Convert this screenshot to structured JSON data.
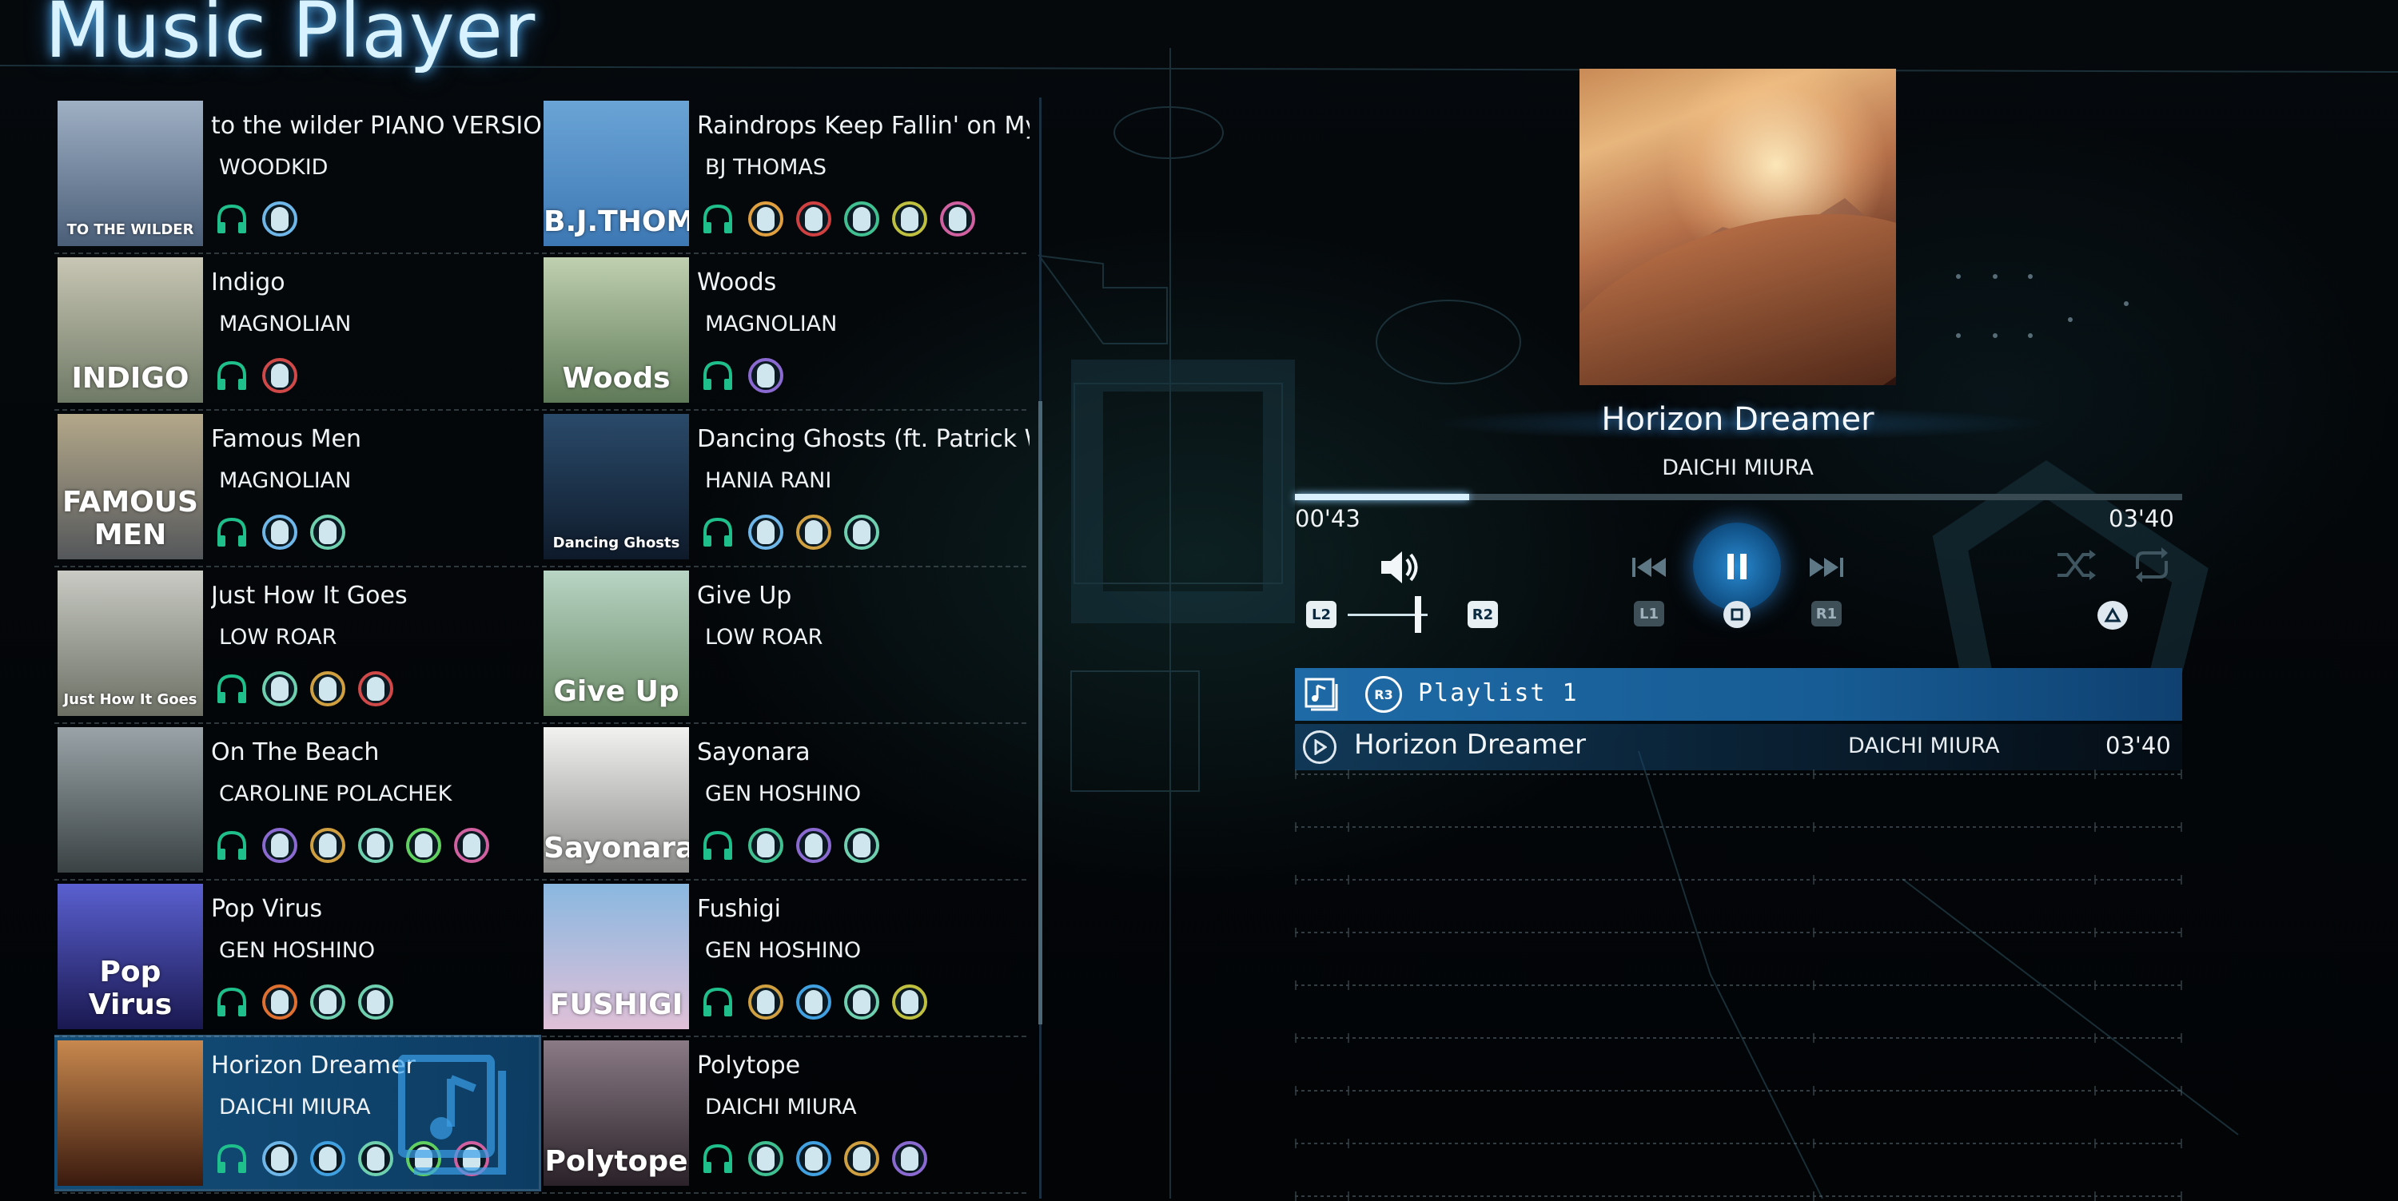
{
  "app": {
    "title": "Music Player"
  },
  "library": {
    "tracks": [
      {
        "title": "to the wilder PIANO VERSION",
        "artist": "WOODKID",
        "cover_text": "TO THE WILDER",
        "cover_colors": [
          "#9fb0c4",
          "#4a5e78"
        ],
        "avatars": [
          "#6fb7e8"
        ]
      },
      {
        "title": "Raindrops Keep Fallin' on My",
        "artist": "BJ THOMAS",
        "cover_text": "B.J.THOMAS",
        "cover_colors": [
          "#6aa4d6",
          "#3d78b4"
        ],
        "avatars": [
          "#e0a040",
          "#d04040",
          "#40c090",
          "#c0c040",
          "#d060a0"
        ]
      },
      {
        "title": "Indigo",
        "artist": "MAGNOLIAN",
        "cover_text": "INDIGO",
        "cover_colors": [
          "#c8c6b4",
          "#6f7a66"
        ],
        "avatars": [
          "#d04848"
        ]
      },
      {
        "title": "Woods",
        "artist": "MAGNOLIAN",
        "cover_text": "Woods",
        "cover_colors": [
          "#bfd0b0",
          "#5f7a58"
        ],
        "avatars": [
          "#8a6ad0"
        ]
      },
      {
        "title": "Famous Men",
        "artist": "MAGNOLIAN",
        "cover_text": "FAMOUS MEN",
        "cover_colors": [
          "#b4a88a",
          "#54575a"
        ],
        "avatars": [
          "#6fb7e8",
          "#6fd0b0"
        ]
      },
      {
        "title": "Dancing Ghosts (ft. Patrick Wa",
        "artist": "HANIA RANI",
        "cover_text": "Dancing Ghosts",
        "cover_colors": [
          "#2a4a6a",
          "#0e1a2a"
        ],
        "avatars": [
          "#6fb7e8",
          "#d0a040",
          "#6fd0b0"
        ]
      },
      {
        "title": "Just How It Goes",
        "artist": "LOW ROAR",
        "cover_text": "Just How It Goes",
        "cover_colors": [
          "#c9cbc4",
          "#6c7064"
        ],
        "avatars": [
          "#6fd0b0",
          "#d0a040",
          "#d04848"
        ]
      },
      {
        "title": "Give Up",
        "artist": "LOW ROAR",
        "cover_text": "Give Up",
        "cover_colors": [
          "#b8d4c4",
          "#6a8a66"
        ],
        "avatars": []
      },
      {
        "title": "On The Beach",
        "artist": "CAROLINE POLACHEK",
        "cover_text": "",
        "cover_colors": [
          "#9aa4a8",
          "#3a4244"
        ],
        "avatars": [
          "#8a6ad0",
          "#d0a040",
          "#6fd0b0",
          "#60d060",
          "#d060a0"
        ]
      },
      {
        "title": "Sayonara",
        "artist": "GEN HOSHINO",
        "cover_text": "Sayonara",
        "cover_colors": [
          "#f2f2f0",
          "#8a8a88"
        ],
        "avatars": [
          "#40c090",
          "#8a6ad0",
          "#6fd0b0"
        ]
      },
      {
        "title": "Pop Virus",
        "artist": "GEN HOSHINO",
        "cover_text": "Pop Virus",
        "cover_colors": [
          "#5a60d0",
          "#1a1850"
        ],
        "avatars": [
          "#e07030",
          "#6fd0b0",
          "#6fd0b0"
        ]
      },
      {
        "title": "Fushigi",
        "artist": "GEN HOSHINO",
        "cover_text": "FUSHIGI",
        "cover_colors": [
          "#8ab8e0",
          "#e0c0d8"
        ],
        "avatars": [
          "#d0a040",
          "#40a0e0",
          "#6fd0b0",
          "#c0c040"
        ]
      },
      {
        "title": "Horizon Dreamer",
        "artist": "DAICHI MIURA",
        "cover_text": "",
        "cover_colors": [
          "#c8884e",
          "#3a1a0e"
        ],
        "avatars": [
          "#6fb7e8",
          "#40a0e0",
          "#6fd0b0",
          "#60d060",
          "#d060a0"
        ]
      },
      {
        "title": "Polytope",
        "artist": "DAICHI MIURA",
        "cover_text": "Polytope",
        "cover_colors": [
          "#8a7a86",
          "#2a2228"
        ],
        "avatars": [
          "#40c090",
          "#40a0e0",
          "#d0a040",
          "#8a6ad0"
        ]
      }
    ],
    "selected_index": 12
  },
  "now_playing": {
    "title": "Horizon Dreamer",
    "artist": "DAICHI MIURA",
    "elapsed": "00'43",
    "total": "03'40",
    "progress": 0.196
  },
  "controls": {
    "volume_down_label": "L2",
    "volume_up_label": "R2",
    "prev_label": "L1",
    "next_label": "R1",
    "volume_level": 0.88
  },
  "playlist": {
    "name": "Playlist 1",
    "switch_label": "R3",
    "items": [
      {
        "title": "Horizon Dreamer",
        "artist": "DAICHI MIURA",
        "duration": "03'40"
      }
    ]
  },
  "colors": {
    "accent": "#1e6aa6",
    "glow": "#6fc8ff",
    "headphone": "#1fbf8c"
  }
}
